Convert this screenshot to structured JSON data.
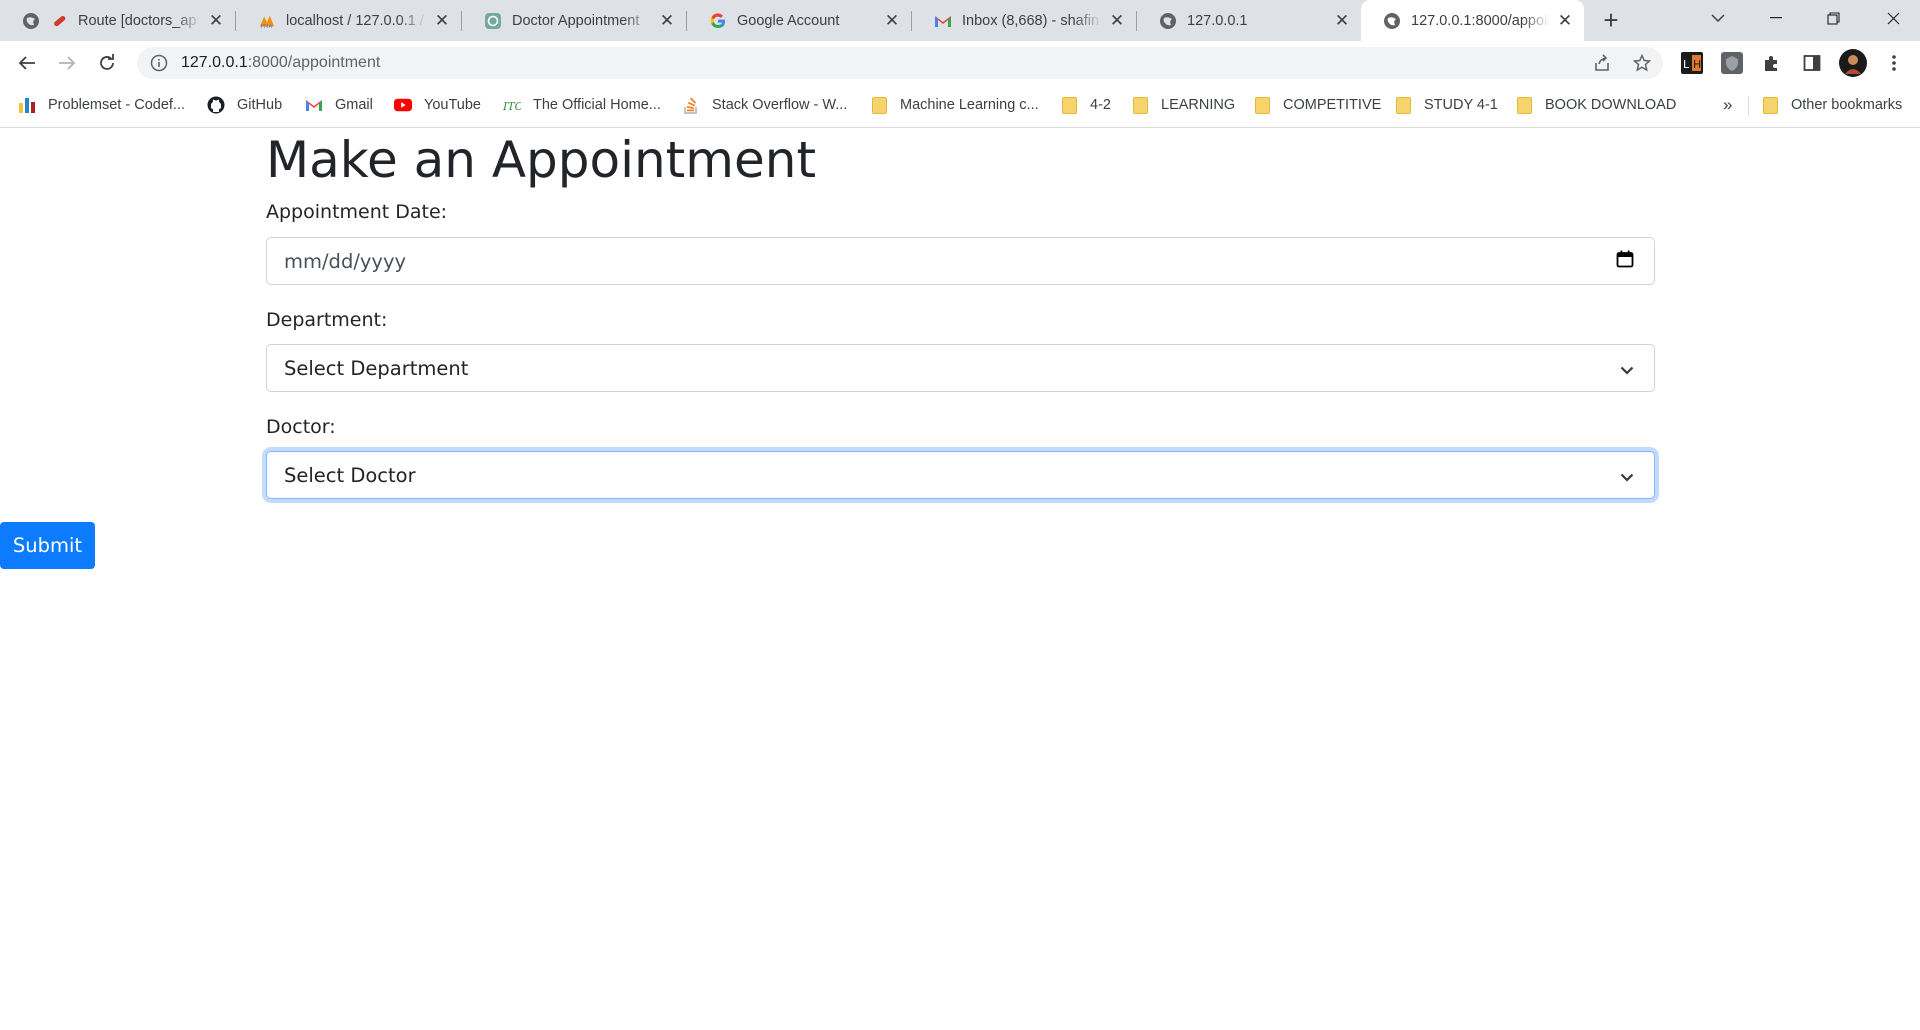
{
  "browser": {
    "tabs": [
      {
        "title": "Route [doctors_ap",
        "favicon": "laravel-icon"
      },
      {
        "title": "localhost / 127.0.0.1 /",
        "favicon": "phpmyadmin-icon"
      },
      {
        "title": "Doctor Appointment",
        "favicon": "chatgpt-icon"
      },
      {
        "title": "Google Account",
        "favicon": "google-icon"
      },
      {
        "title": "Inbox (8,668) - shafin",
        "favicon": "gmail-icon"
      },
      {
        "title": "127.0.0.1",
        "favicon": "globe-icon"
      },
      {
        "title": "127.0.0.1:8000/appoin",
        "favicon": "globe-icon",
        "active": true
      }
    ],
    "url_host": "127.0.0.1",
    "url_rest": ":8000/appointment",
    "bookmarks": [
      {
        "label": "Problemset - Codef...",
        "icon": "codeforces-icon"
      },
      {
        "label": "GitHub",
        "icon": "github-icon"
      },
      {
        "label": "Gmail",
        "icon": "gmail-icon"
      },
      {
        "label": "YouTube",
        "icon": "youtube-icon"
      },
      {
        "label": "The Official Home...",
        "icon": "site-icon"
      },
      {
        "label": "Stack Overflow - W...",
        "icon": "stackoverflow-icon"
      },
      {
        "label": "Machine Learning c...",
        "icon": "folder-icon"
      },
      {
        "label": "4-2",
        "icon": "folder-icon"
      },
      {
        "label": "LEARNING",
        "icon": "folder-icon"
      },
      {
        "label": "COMPETITIVE",
        "icon": "folder-icon"
      },
      {
        "label": "STUDY 4-1",
        "icon": "folder-icon"
      },
      {
        "label": "BOOK DOWNLOAD",
        "icon": "folder-icon"
      }
    ],
    "overflow_label": "»",
    "other_bookmarks": "Other bookmarks"
  },
  "form": {
    "title": "Make an Appointment",
    "date_label": "Appointment Date:",
    "date_placeholder": "mm/dd/yyyy",
    "department_label": "Department:",
    "department_selected": "Select Department",
    "doctor_label": "Doctor:",
    "doctor_selected": "Select Doctor",
    "submit_label": "Submit"
  },
  "colors": {
    "primary": "#0d7bfd",
    "focus_ring": "#86b7fe",
    "text": "#212529"
  }
}
